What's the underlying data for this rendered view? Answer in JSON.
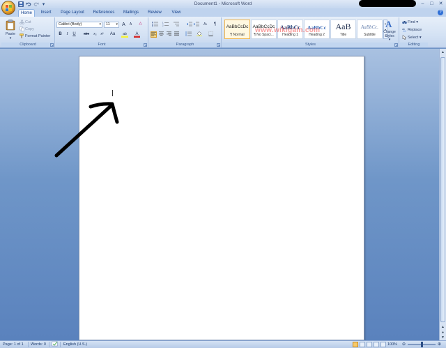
{
  "window": {
    "title": "Document1 - Microsoft Word",
    "controls": {
      "minimize": "‒",
      "maximize": "□",
      "close": "✕"
    }
  },
  "qat": {
    "save_icon": "save-icon",
    "undo_icon": "undo-icon",
    "redo_icon": "redo-icon",
    "customize": "▾"
  },
  "tabs": [
    {
      "label": "Home",
      "active": true
    },
    {
      "label": "Insert"
    },
    {
      "label": "Page Layout"
    },
    {
      "label": "References"
    },
    {
      "label": "Mailings"
    },
    {
      "label": "Review"
    },
    {
      "label": "View"
    }
  ],
  "help": "?",
  "clipboard": {
    "paste": "Paste",
    "paste_arrow": "▾",
    "cut": "Cut",
    "copy": "Copy",
    "format_painter": "Format Painter",
    "label": "Clipboard"
  },
  "font": {
    "name": "Calibri (Body)",
    "size": "11",
    "grow": "A",
    "shrink": "A",
    "clear": "A",
    "bold": "B",
    "italic": "I",
    "underline": "U",
    "strike": "abc",
    "subscript": "x₂",
    "superscript": "x²",
    "change_case": "Aa",
    "highlight": "ab",
    "color": "A",
    "label": "Font"
  },
  "paragraph": {
    "sort": "A↓",
    "pilcrow": "¶",
    "label": "Paragraph"
  },
  "styles": {
    "items": [
      {
        "sample": "AaBbCcDc",
        "name": "¶ Normal",
        "selected": true
      },
      {
        "sample": "AaBbCcDc",
        "name": "¶ No Spaci..."
      },
      {
        "sample": "AaBbCc",
        "name": "Heading 1"
      },
      {
        "sample": "AaBbCc",
        "name": "Heading 2"
      },
      {
        "sample": "AaB",
        "name": "Title"
      },
      {
        "sample": "AaBbCc.",
        "name": "Subtitle"
      }
    ],
    "change_styles": "Change Styles",
    "change_styles_arrow": "▾",
    "label": "Styles"
  },
  "editing": {
    "find": "Find",
    "replace": "Replace",
    "select": "Select",
    "arrow": "▾",
    "label": "Editing"
  },
  "watermark": "www.wikigain.com",
  "status": {
    "page": "Page: 1 of 1",
    "words": "Words: 0",
    "language": "English (U.S.)",
    "zoom": "100%",
    "zoom_out": "⊖",
    "zoom_in": "⊕"
  },
  "colors": {
    "ribbon_bg": "#dbe6f5",
    "accent": "#15428b",
    "workspace": "#6f96c8",
    "style_selected": "#f0b34a"
  }
}
